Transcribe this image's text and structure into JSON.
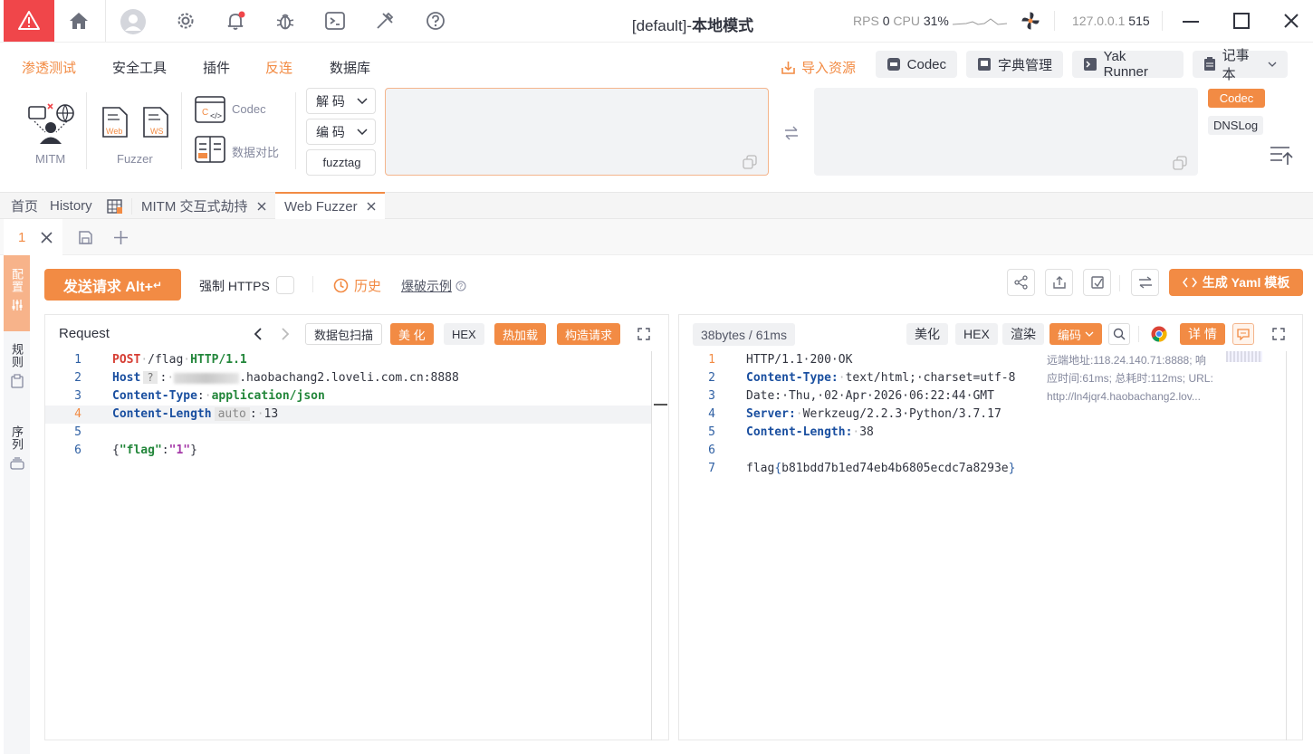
{
  "window": {
    "title_prefix": "[default]-",
    "title_main": "本地模式",
    "rps_label": "RPS",
    "rps_value": "0",
    "cpu_label": "CPU",
    "cpu_value": "31%",
    "address": "127.0.0.1",
    "port": "515"
  },
  "menu": {
    "items": [
      "渗透测试",
      "安全工具",
      "插件",
      "反连",
      "数据库"
    ],
    "import_label": "导入资源",
    "quick": [
      "Codec",
      "字典管理",
      "Yak Runner",
      "记事本"
    ]
  },
  "tools": {
    "mitm_label": "MITM",
    "fuzzer_label": "Fuzzer",
    "web_sub": "Web",
    "ws_sub": "WS",
    "codec_label": "Codec",
    "compare_label": "数据对比",
    "decode_label": "解 码",
    "encode_label": "编 码",
    "fuzztag_label": "fuzztag",
    "side_codec": "Codec",
    "side_dnslog": "DNSLog"
  },
  "tabs": {
    "home": "首页",
    "history": "History",
    "mitm": "MITM 交互式劫持",
    "fuzzer": "Web Fuzzer"
  },
  "subtab": {
    "index": "1"
  },
  "side": {
    "config": "配置",
    "rules": "规则",
    "sequence": "序列"
  },
  "toolbar": {
    "send": "发送请求 Alt+",
    "force_https": "强制 HTTPS",
    "history": "历史",
    "example": "爆破示例",
    "yaml": "生成 Yaml 模板"
  },
  "request": {
    "title": "Request",
    "btn_scan": "数据包扫描",
    "btn_beautify": "美 化",
    "btn_hex": "HEX",
    "btn_hotload": "热加载",
    "btn_build": "构造请求",
    "lines": [
      {
        "n": "1"
      },
      {
        "n": "2"
      },
      {
        "n": "3"
      },
      {
        "n": "4"
      },
      {
        "n": "5"
      },
      {
        "n": "6"
      }
    ],
    "method": "POST",
    "path": "/flag",
    "proto": "HTTP/1.1",
    "host_key": "Host",
    "host_badge": "?",
    "host_value": ".haobachang2.loveli.com.cn:8888",
    "ct_key": "Content-Type",
    "ct_value": "application/json",
    "cl_key": "Content-Length",
    "cl_badge": "auto",
    "cl_value": "13",
    "body_open": "{",
    "body_key": "\"flag\"",
    "body_colon": ":",
    "body_val": "\"1\"",
    "body_close": "}"
  },
  "response": {
    "size": "38bytes / 61ms",
    "btn_beautify": "美化",
    "btn_hex": "HEX",
    "btn_render": "渲染",
    "btn_encode": "编码",
    "btn_detail": "详 情",
    "lines": [
      "1",
      "2",
      "3",
      "4",
      "5",
      "6",
      "7"
    ],
    "status": "HTTP/1.1·200·OK",
    "ct_key": "Content-Type:",
    "ct_value": "text/html;·charset=utf-8",
    "date": "Date:·Thu,·02·Apr·2026·06:22:44·GMT",
    "server_key": "Server:",
    "server_value": "Werkzeug/2.2.3·Python/3.7.17",
    "cl_key": "Content-Length:",
    "cl_value": "38",
    "flag_prefix": "flag",
    "flag_open": "{",
    "flag_body": "b81bdd7b1ed74eb4b6805ecdc7a8293e",
    "flag_close": "}",
    "info_1": "远端地址:118.24.140.71:8888; 响",
    "info_2": "应时间:61ms; 总耗时:112ms; URL:",
    "info_3": "http://ln4jqr4.haobachang2.lov..."
  },
  "colors": {
    "accent": "#f28b44",
    "logo_bg": "#f0464a",
    "keyword": "#1a4fa0"
  }
}
